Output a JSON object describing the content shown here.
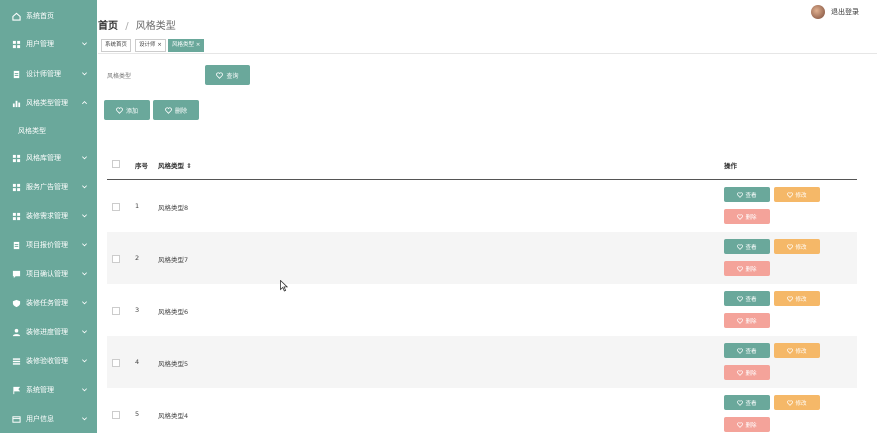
{
  "sidebar": {
    "items": [
      {
        "label": "系统首页",
        "icon": "home-icon",
        "chevron": false
      },
      {
        "label": "用户管理",
        "icon": "grid-icon",
        "chevron": true
      },
      {
        "label": "设计师管理",
        "icon": "doc-icon",
        "chevron": true
      },
      {
        "label": "风格类型管理",
        "icon": "bar-chart-icon",
        "chevron": true,
        "expanded": true
      },
      {
        "label": "风格类型",
        "sub": true
      },
      {
        "label": "风格库管理",
        "icon": "grid-icon",
        "chevron": true
      },
      {
        "label": "服务广告管理",
        "icon": "grid-icon",
        "chevron": true
      },
      {
        "label": "装修需求管理",
        "icon": "grid-icon",
        "chevron": true
      },
      {
        "label": "项目报价管理",
        "icon": "doc-icon",
        "chevron": true
      },
      {
        "label": "项目确认管理",
        "icon": "chat-icon",
        "chevron": true
      },
      {
        "label": "装修任务管理",
        "icon": "shield-icon",
        "chevron": true
      },
      {
        "label": "装修进度管理",
        "icon": "user-icon",
        "chevron": true
      },
      {
        "label": "装修验收管理",
        "icon": "list-icon",
        "chevron": true
      },
      {
        "label": "系统管理",
        "icon": "flag-icon",
        "chevron": true
      },
      {
        "label": "用户信息",
        "icon": "card-icon",
        "chevron": true
      }
    ]
  },
  "header": {
    "home": "首页",
    "separator": "/",
    "current": "风格类型",
    "logout": "退出登录"
  },
  "tabs": [
    {
      "label": "系统首页",
      "closable": false,
      "active": false
    },
    {
      "label": "设计师 ×",
      "closable": true,
      "active": false
    },
    {
      "label": "风格类型 ×",
      "closable": true,
      "active": true
    }
  ],
  "search": {
    "placeholder": "风格类型",
    "query_label": "查询"
  },
  "actions": {
    "add_label": "添加",
    "delete_label": "删除"
  },
  "table": {
    "headers": {
      "index": "序号",
      "style": "风格类型 ⇕",
      "ops": "操作"
    },
    "rows": [
      {
        "index": "1",
        "style": "风格类型8"
      },
      {
        "index": "2",
        "style": "风格类型7"
      },
      {
        "index": "3",
        "style": "风格类型6"
      },
      {
        "index": "4",
        "style": "风格类型5"
      },
      {
        "index": "5",
        "style": "风格类型4"
      }
    ],
    "view_label": "查看",
    "edit_label": "修改",
    "delete_label": "删除"
  },
  "colors": {
    "primary": "#6aa89b",
    "warn": "#f5b868",
    "danger": "#f4a39a"
  }
}
